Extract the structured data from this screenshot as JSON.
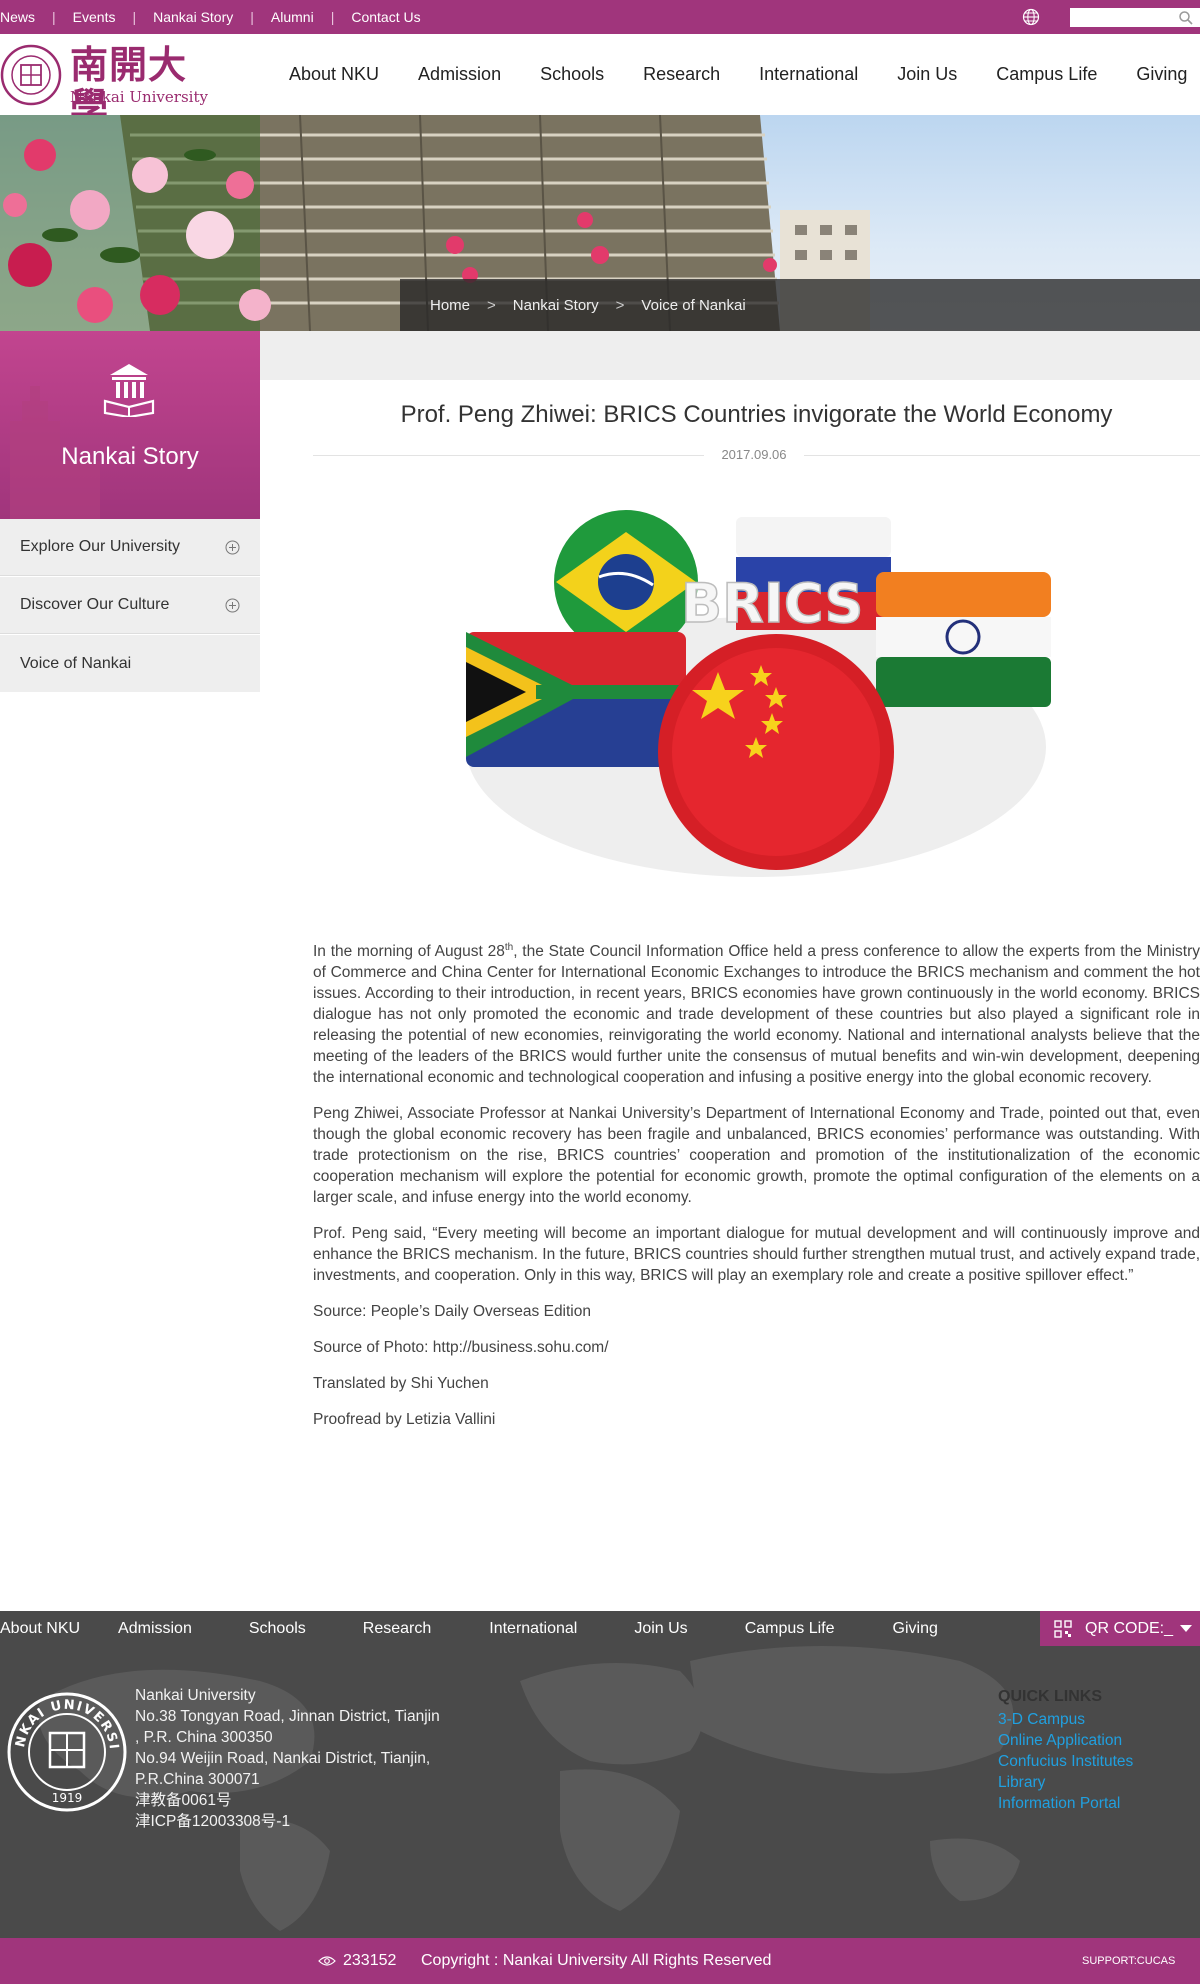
{
  "topbar": {
    "links": [
      "News",
      "Events",
      "Nankai Story",
      "Alumni",
      "Contact Us"
    ],
    "search_placeholder": ""
  },
  "header": {
    "logo_cn": "南開大學",
    "logo_en": "Nankai University",
    "nav": [
      "About NKU",
      "Admission",
      "Schools",
      "Research",
      "International",
      "Join Us",
      "Campus Life",
      "Giving"
    ]
  },
  "breadcrumb": [
    "Home",
    "Nankai Story",
    "Voice of Nankai"
  ],
  "sidebar": {
    "title": "Nankai Story",
    "items": [
      {
        "label": "Explore Our University",
        "expandable": true
      },
      {
        "label": "Discover Our Culture",
        "expandable": true
      },
      {
        "label": "Voice of Nankai",
        "expandable": false
      }
    ]
  },
  "article": {
    "title": "Prof. Peng Zhiwei: BRICS Countries invigorate the World Economy",
    "date": "2017.09.06",
    "image_text": "BRICS",
    "p1_before": "In the morning of August 28",
    "p1_sup": "th",
    "p1_after": ", the State Council Information Office held a press conference to allow the experts from the Ministry of Commerce and China Center for International Economic Exchanges to introduce the BRICS mechanism and comment the hot issues. According to their introduction, in recent years, BRICS economies have grown continuously in the world economy. BRICS dialogue has not only promoted the economic and trade development of these countries but also played a significant role in releasing the potential of new economies, reinvigorating the world economy. National and international analysts believe that the meeting of the leaders of the BRICS would further unite the consensus of mutual benefits and win-win development, deepening the international economic and technological cooperation and infusing a positive energy into the global economic recovery.",
    "p2": "Peng Zhiwei, Associate Professor at Nankai University’s Department of International Economy and Trade, pointed out that, even though the global economic recovery has been fragile and unbalanced, BRICS economies’ performance was outstanding. With trade protectionism on the rise, BRICS countries’ cooperation and promotion of the institutionalization of the economic cooperation mechanism will explore the potential for economic growth, promote the optimal configuration of the elements on a larger scale, and infuse energy into the world economy.",
    "p3": "Prof. Peng said, “Every meeting will become an important dialogue for mutual development and will continuously improve and enhance the BRICS mechanism. In the future, BRICS countries should further strengthen mutual trust, and actively expand trade, investments, and cooperation. Only in this way, BRICS will play an exemplary role and create a positive spillover effect.”",
    "source": "Source: People’s Daily Overseas Edition",
    "photo_source": "Source of Photo: http://business.sohu.com/",
    "translated": "Translated by Shi Yuchen",
    "proofread": "Proofread by Letizia Vallini"
  },
  "footer": {
    "nav": [
      "About NKU",
      "Admission",
      "Schools",
      "Research",
      "International",
      "Join Us",
      "Campus Life",
      "Giving"
    ],
    "qr_label": "QR CODE:_",
    "seal_text": "NANKAI UNIVERSITY",
    "seal_year": "1919",
    "address_lines": [
      "Nankai University",
      "No.38 Tongyan Road, Jinnan District, Tianjin",
      ", P.R. China 300350",
      "No.94 Weijin Road,  Nankai District, Tianjin,",
      "P.R.China  300071",
      "津教备0061号",
      "津ICP备12003308号-1"
    ],
    "quick_links_title": "QUICK LINKS",
    "quick_links": [
      "3-D Campus",
      "Online Application",
      "Confucius Institutes",
      "Library",
      "Information Portal"
    ],
    "visits": "233152",
    "copyright": "Copyright : Nankai University All Rights Reserved",
    "support": "SUPPORT:CUCAS"
  },
  "colors": {
    "brand": "#a0357c",
    "link": "#20a0e0",
    "footer_bg": "#4a4a4a"
  }
}
